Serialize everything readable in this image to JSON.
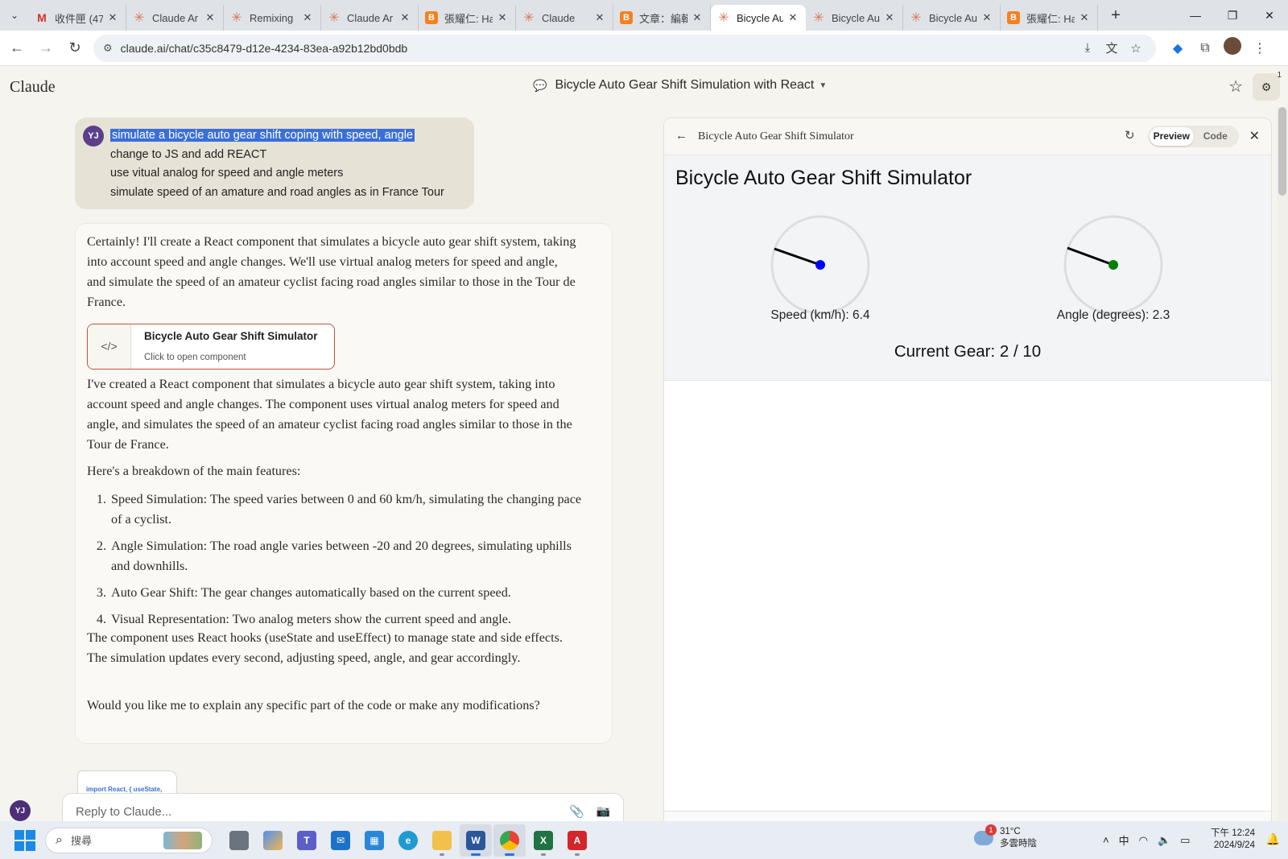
{
  "browser": {
    "tabs": [
      {
        "title": "收件匣 (47",
        "favicon": "gmail-icon",
        "active": false
      },
      {
        "title": "Claude Ar",
        "favicon": "claude-icon",
        "active": false
      },
      {
        "title": "Remixing",
        "favicon": "claude-icon",
        "active": false
      },
      {
        "title": "Claude Ar",
        "favicon": "claude-icon",
        "active": false
      },
      {
        "title": "張耀仁: Ha",
        "favicon": "blogger-icon",
        "active": false
      },
      {
        "title": "Claude",
        "favicon": "claude-icon",
        "active": false
      },
      {
        "title": "文章：編輯",
        "favicon": "blogger-icon",
        "active": false
      },
      {
        "title": "Bicycle Au",
        "favicon": "claude-icon",
        "active": true
      },
      {
        "title": "Bicycle Au",
        "favicon": "claude-icon",
        "active": false
      },
      {
        "title": "Bicycle Au",
        "favicon": "claude-icon",
        "active": false
      },
      {
        "title": "張耀仁: Ha",
        "favicon": "blogger-icon",
        "active": false
      }
    ],
    "url": "claude.ai/chat/c35c8479-d12e-4234-83ea-a92b12bd0bdb"
  },
  "app": {
    "brand": "Claude",
    "chat_title": "Bicycle Auto Gear Shift Simulation with React",
    "settings_badge": "1"
  },
  "user_message": {
    "avatar": "YJ",
    "lines": [
      "simulate a bicycle auto gear shift coping with speed, angle",
      "change to JS and add REACT",
      "use vitual analog for speed and angle meters",
      "simulate speed of an amature and road angles as in France Tour"
    ]
  },
  "assistant_message": {
    "intro": "Certainly! I'll create a React component that simulates a bicycle auto gear shift system, taking into account speed and angle changes. We'll use virtual analog meters for speed and angle, and simulate the speed of an amateur cyclist facing road angles similar to those in the Tour de France.",
    "artifact_title": "Bicycle Auto Gear Shift Simulator",
    "artifact_subtitle": "Click to open component",
    "para2": "I've created a React component that simulates a bicycle auto gear shift system, taking into account speed and angle changes. The component uses virtual analog meters for speed and angle, and simulates the speed of an amateur cyclist facing road angles similar to those in the Tour de France.",
    "para3": "Here's a breakdown of the main features:",
    "features": [
      {
        "num": "1.",
        "text": "Speed Simulation: The speed varies between 0 and 60 km/h, simulating the changing pace of a cyclist."
      },
      {
        "num": "2.",
        "text": "Angle Simulation: The road angle varies between -20 and 20 degrees, simulating uphills and downhills."
      },
      {
        "num": "3.",
        "text": "Auto Gear Shift: The gear changes automatically based on the current speed."
      },
      {
        "num": "4.",
        "text": "Visual Representation: Two analog meters show the current speed and angle."
      }
    ],
    "para4": "The component uses React hooks (useState and useEffect) to manage state and side effects. The simulation updates every second, adjusting speed, angle, and gear accordingly.",
    "para5": "Would you like me to explain any specific part of the code or make any modifications?"
  },
  "snippet_text": "import React, { useState,",
  "reply": {
    "placeholder": "Reply to Claude...",
    "avatar": "YJ"
  },
  "artifact_panel": {
    "title": "Bicycle Auto Gear Shift Simulator",
    "preview_label": "Preview",
    "code_label": "Code",
    "sim_title": "Bicycle Auto Gear Shift Simulator",
    "speed_label": "Speed (km/h): 6.4",
    "angle_label": "Angle (degrees): 2.3",
    "gear_label": "Current Gear: 2 / 10",
    "speed_color": "#0000ff",
    "angle_color": "#008000"
  },
  "taskbar": {
    "search_placeholder": "搜尋",
    "weather_temp": "31°C",
    "weather_desc": "多雲時陰",
    "weather_badge": "1",
    "ime": "中",
    "time": "下午 12:24",
    "date": "2024/9/24"
  }
}
